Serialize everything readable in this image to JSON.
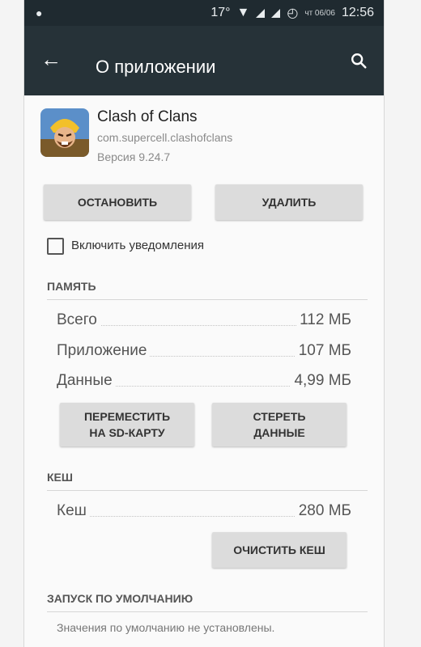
{
  "status_bar": {
    "temperature": "17°",
    "date": "чт 06/06",
    "time": "12:56"
  },
  "app_bar": {
    "title": "О приложении",
    "back_icon": "arrow-back-icon",
    "search_icon": "search-icon"
  },
  "app": {
    "name": "Clash of Clans",
    "package": "com.supercell.clashofclans",
    "version": "Версия 9.24.7"
  },
  "actions": {
    "stop_label": "ОСТАНОВИТЬ",
    "uninstall_label": "УДАЛИТЬ"
  },
  "notifications": {
    "label": "Включить уведомления",
    "checked": false
  },
  "memory": {
    "header": "ПАМЯТЬ",
    "rows": [
      {
        "label": "Всего",
        "value": "112 МБ"
      },
      {
        "label": "Приложение",
        "value": "107 МБ"
      },
      {
        "label": "Данные",
        "value": "4,99 МБ"
      }
    ],
    "move_label_line1": "ПЕРЕМЕСТИТЬ",
    "move_label_line2": "НА SD-КАРТУ",
    "clear_label_line1": "СТЕРЕТЬ",
    "clear_label_line2": "ДАННЫЕ"
  },
  "cache": {
    "header": "КЕШ",
    "rows": [
      {
        "label": "Кеш",
        "value": "280 МБ"
      }
    ],
    "clear_cache_label": "ОЧИСТИТЬ КЕШ"
  },
  "defaults": {
    "header": "ЗАПУСК ПО УМОЛЧАНИЮ",
    "text": "Значения по умолчанию не установлены."
  },
  "colors": {
    "app_bar": "#263238",
    "status_bar": "#1f2a30",
    "button": "#dcdcdc"
  }
}
